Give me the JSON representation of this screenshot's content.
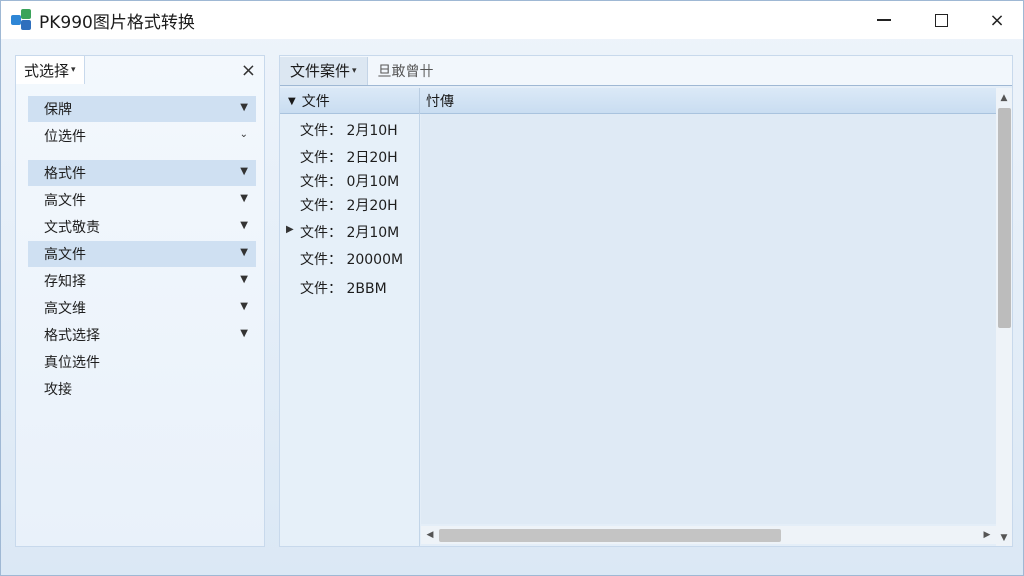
{
  "window": {
    "title": "PK990图片格式转换",
    "icon": "app-logo-icon",
    "controls": {
      "minimize": "minimize-icon",
      "maximize": "maximize-icon",
      "close": "×"
    }
  },
  "left_panel": {
    "tab_label": "式选择",
    "close_label": "×",
    "groups": [
      {
        "items": [
          {
            "label": "保牌",
            "expandable": true,
            "highlighted": true
          },
          {
            "label": "位选件",
            "expandable": true,
            "highlighted": false
          }
        ]
      },
      {
        "items": [
          {
            "label": "格式件",
            "expandable": true,
            "highlighted": true
          },
          {
            "label": "高文件",
            "expandable": true,
            "highlighted": false
          },
          {
            "label": "文式敬责",
            "expandable": true,
            "highlighted": false
          },
          {
            "label": "高文件",
            "expandable": true,
            "highlighted": true
          },
          {
            "label": "存知择",
            "expandable": true,
            "highlighted": false
          },
          {
            "label": "高文维",
            "expandable": true,
            "highlighted": false
          },
          {
            "label": "格式选择",
            "expandable": true,
            "highlighted": false
          },
          {
            "label": "真位选件",
            "expandable": false,
            "highlighted": false
          },
          {
            "label": "攻接",
            "expandable": false,
            "highlighted": false
          }
        ]
      }
    ]
  },
  "right_panel": {
    "toolbar_tab": "文件案件",
    "toolbar_label": "旦敢曾卄",
    "column_file": "文件",
    "column_prop": "忖傳",
    "tree_items": [
      {
        "label": "文件： 2月10H",
        "expand": false
      },
      {
        "label": "文件： 2日20H",
        "expand": false
      },
      {
        "label": "文件： 0月10M",
        "expand": false
      },
      {
        "label": "文件： 2月20H",
        "expand": false
      },
      {
        "label": "文件： 2月10M",
        "expand": true
      },
      {
        "label": "文件： 20000M",
        "expand": false
      },
      {
        "label": "文件： 2BBM",
        "expand": false
      }
    ],
    "scroll_arrows": {
      "up": "▲",
      "down": "▼",
      "left": "◀",
      "right": "▶"
    }
  }
}
